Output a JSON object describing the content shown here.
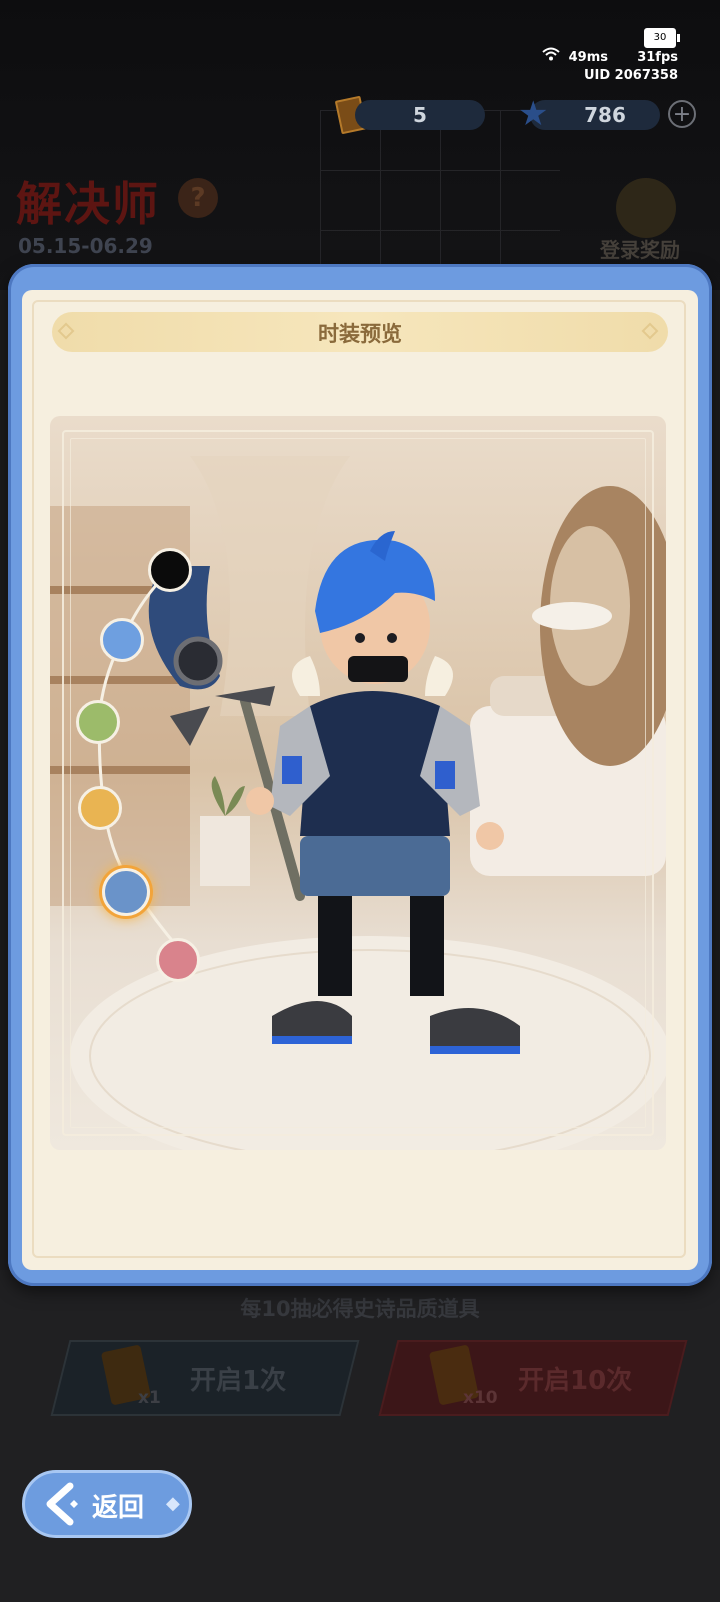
{
  "status_bar": {
    "battery": "30",
    "ping": "49ms",
    "fps": "31fps",
    "uid": "UID 2067358"
  },
  "resources": {
    "ticket_count": "5",
    "star_count": "786"
  },
  "event": {
    "title": "解决师",
    "date_range": "05.15-06.29",
    "login_reward": "登录奖励"
  },
  "modal": {
    "title": "时装预览"
  },
  "color_options": [
    {
      "name": "black",
      "color": "#0b0b0b",
      "selected": false
    },
    {
      "name": "blue",
      "color": "#6e9fe0",
      "selected": false
    },
    {
      "name": "green",
      "color": "#9cbb6a",
      "selected": false
    },
    {
      "name": "yellow",
      "color": "#e9b452",
      "selected": false
    },
    {
      "name": "steel-blue",
      "color": "#6a93c9",
      "selected": true
    },
    {
      "name": "pink",
      "color": "#d9838c",
      "selected": false
    }
  ],
  "draw": {
    "guarantee_text": "每10抽必得史诗品质道具",
    "single_label": "开启1次",
    "single_cost": "x1",
    "ten_label": "开启10次",
    "ten_cost": "x10"
  },
  "back_button": {
    "label": "返回"
  }
}
